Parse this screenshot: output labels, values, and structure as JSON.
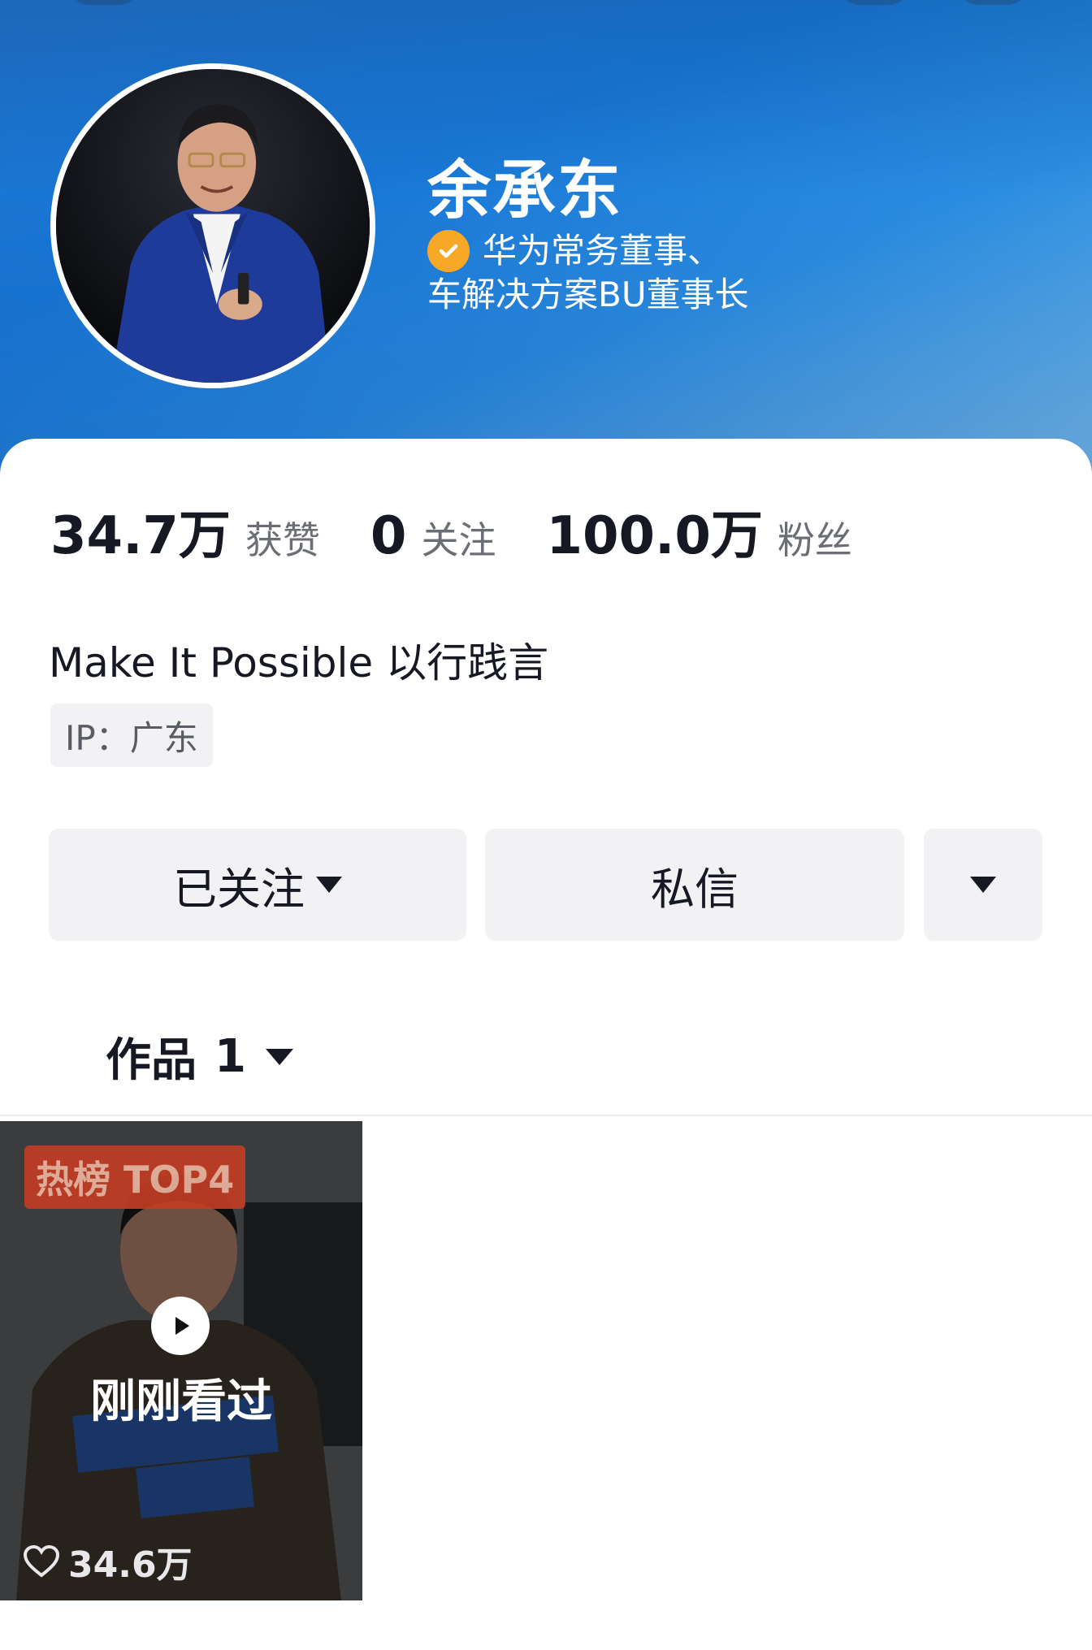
{
  "profile": {
    "name": "余承东",
    "cert_line1": "华为常务董事、",
    "cert_line2": "车解决方案BU董事长",
    "bio": "Make It Possible 以行践言",
    "ip": "IP：广东"
  },
  "stats": [
    {
      "value": "34.7万",
      "label": "获赞"
    },
    {
      "value": "0",
      "label": "关注"
    },
    {
      "value": "100.0万",
      "label": "粉丝"
    }
  ],
  "actions": {
    "follow_label": "已关注",
    "message_label": "私信"
  },
  "works": {
    "tab_label": "作品",
    "count": "1",
    "items": [
      {
        "badge": "热榜 TOP4",
        "status": "刚刚看过",
        "likes": "34.6万"
      }
    ]
  },
  "colors": {
    "banner_blue": "#1877d6",
    "cert_orange": "#f8a827",
    "hot_red": "#c53d23"
  },
  "icons": [
    "back-icon",
    "search-icon",
    "more-icon",
    "verified-icon",
    "play-icon",
    "heart-icon",
    "dropdown-icon"
  ]
}
